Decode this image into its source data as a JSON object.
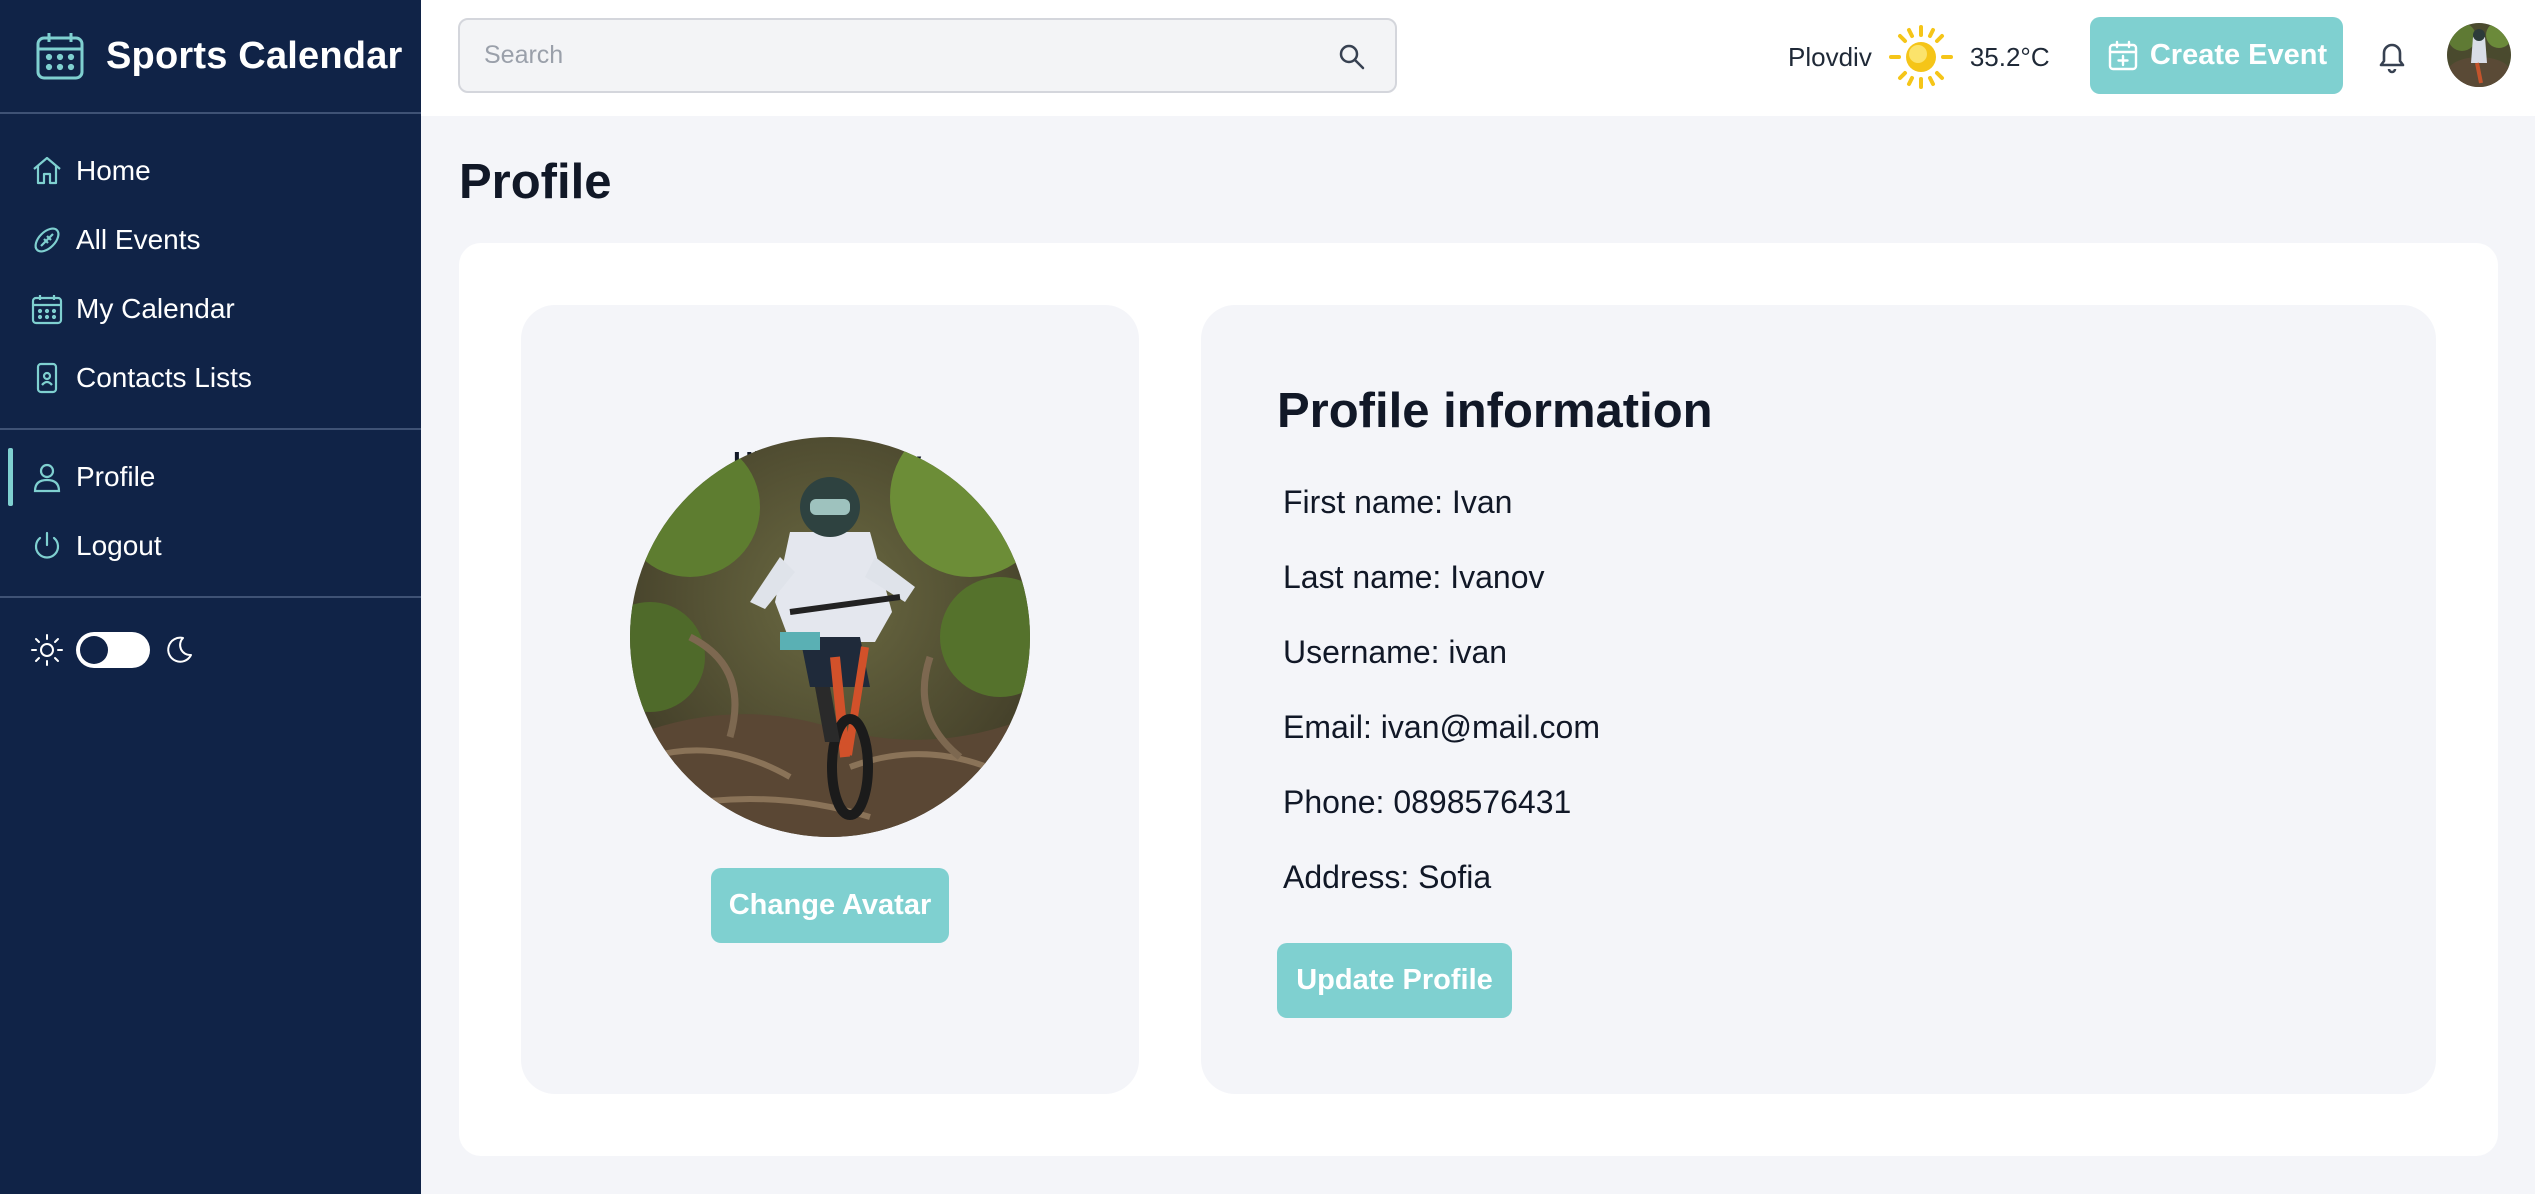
{
  "app": {
    "title": "Sports Calendar"
  },
  "sidebar": {
    "items": [
      {
        "label": "Home",
        "icon": "home-icon"
      },
      {
        "label": "All Events",
        "icon": "ball-icon"
      },
      {
        "label": "My Calendar",
        "icon": "calendar-icon"
      },
      {
        "label": "Contacts Lists",
        "icon": "phone-contact-icon"
      },
      {
        "label": "Profile",
        "icon": "user-icon",
        "active": true
      },
      {
        "label": "Logout",
        "icon": "power-icon"
      }
    ],
    "theme": {
      "light_icon": "sun-icon",
      "dark_icon": "moon-icon",
      "dark_mode": false
    }
  },
  "topbar": {
    "search": {
      "placeholder": "Search",
      "value": ""
    },
    "weather": {
      "city": "Plovdiv",
      "temperature": "35.2°C",
      "icon": "sun-icon"
    },
    "create_label": "Create Event",
    "notification_icon": "bell-icon"
  },
  "page": {
    "title": "Profile"
  },
  "profile": {
    "greeting": "Hi Ivan Ivanov,",
    "change_avatar_label": "Change Avatar",
    "info_title": "Profile information",
    "lines": [
      "First name: Ivan",
      "Last name: Ivanov",
      "Username: ivan",
      "Email: ivan@mail.com",
      "Phone: 0898576431",
      "Address: Sofia"
    ],
    "update_label": "Update Profile"
  },
  "colors": {
    "sidebar_bg": "#102347",
    "accent": "#7fd0d0",
    "page_bg": "#f4f5f9",
    "sun": "#f5c518"
  }
}
